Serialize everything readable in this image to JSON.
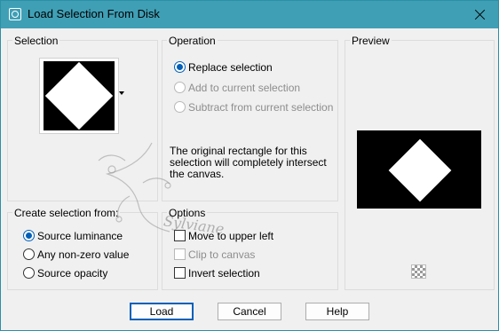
{
  "window": {
    "title": "Load Selection From Disk",
    "close_icon": "close-icon",
    "app_icon": "selection-app-icon"
  },
  "selection": {
    "label": "Selection"
  },
  "operation": {
    "label": "Operation",
    "options": [
      {
        "label": "Replace selection",
        "checked": true,
        "enabled": true
      },
      {
        "label": "Add to current selection",
        "checked": false,
        "enabled": false
      },
      {
        "label": "Subtract from current selection",
        "checked": false,
        "enabled": false
      }
    ],
    "info": "The original rectangle for this selection will completely intersect the canvas."
  },
  "preview": {
    "label": "Preview",
    "checker_icon": "transparency-checker-icon"
  },
  "create_from": {
    "label": "Create selection from:",
    "options": [
      {
        "label": "Source luminance",
        "checked": true
      },
      {
        "label": "Any non-zero value",
        "checked": false
      },
      {
        "label": "Source opacity",
        "checked": false
      }
    ]
  },
  "options": {
    "label": "Options",
    "items": [
      {
        "label": "Move to upper left",
        "checked": false,
        "enabled": true
      },
      {
        "label": "Clip to canvas",
        "checked": false,
        "enabled": false
      },
      {
        "label": "Invert selection",
        "checked": false,
        "enabled": true
      }
    ]
  },
  "buttons": {
    "load": "Load",
    "cancel": "Cancel",
    "help": "Help"
  },
  "watermark": {
    "text": "Sylviane"
  },
  "colors": {
    "titlebar": "#3f9fb5",
    "accent": "#005fb8",
    "background": "#f0f0f0"
  }
}
